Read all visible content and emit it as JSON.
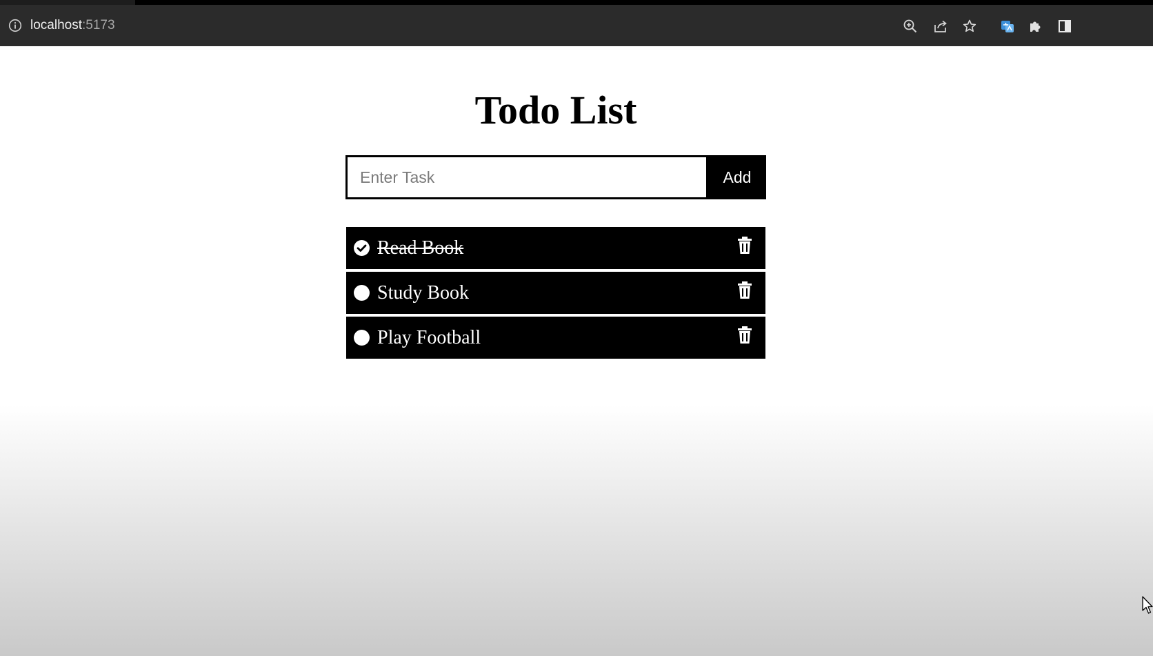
{
  "browser": {
    "url_host": "localhost",
    "url_port": ":5173",
    "toolbar_icons": [
      "info-icon",
      "zoom-icon",
      "share-icon",
      "bookmark-star-icon",
      "translate-extension-icon",
      "extensions-puzzle-icon",
      "side-panel-icon"
    ]
  },
  "app": {
    "title": "Todo List",
    "input": {
      "placeholder": "Enter Task",
      "value": ""
    },
    "add_label": "Add",
    "tasks": [
      {
        "text": "Read Book",
        "completed": true
      },
      {
        "text": "Study Book",
        "completed": false
      },
      {
        "text": "Play Football",
        "completed": false
      }
    ]
  },
  "colors": {
    "item_background": "#000000",
    "item_text": "#ffffff",
    "chrome_background": "#2b2b2b"
  }
}
